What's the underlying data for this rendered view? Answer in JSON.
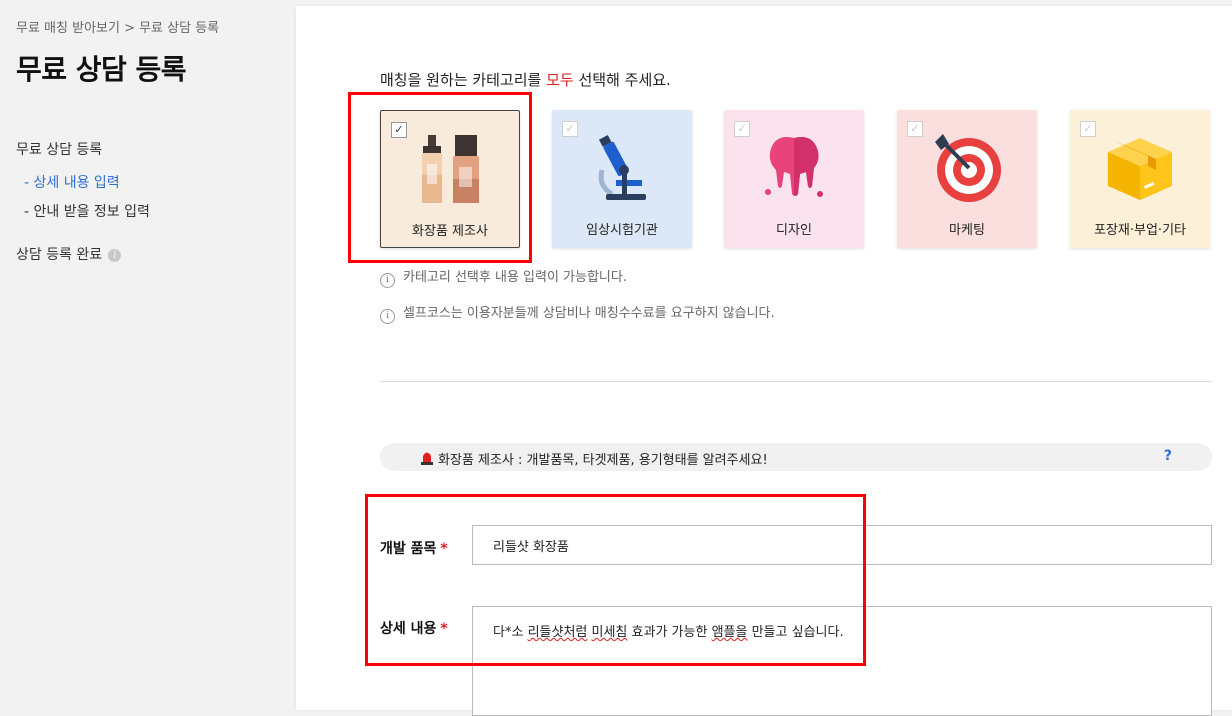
{
  "sidebar": {
    "breadcrumb": "무료 매칭 받아보기 > 무료 상담 등록",
    "title": "무료 상담 등록",
    "nav": {
      "section1": "무료 상담 등록",
      "sub1": "- 상세 내용 입력",
      "sub2": "- 안내 받을 정보 입력",
      "section2": "상담 등록 완료"
    }
  },
  "main": {
    "instruction_pre": "매칭을 원하는 카테고리를 ",
    "instruction_hl": "모두",
    "instruction_post": " 선택해 주세요.",
    "categories": [
      {
        "label": "화장품 제조사",
        "selected": true,
        "bg": "#f8ebdb",
        "icon": "cosmetics-bottles-icon"
      },
      {
        "label": "임상시험기관",
        "selected": false,
        "bg": "#dce7f7",
        "icon": "microscope-icon"
      },
      {
        "label": "디자인",
        "selected": false,
        "bg": "#fbe3ee",
        "icon": "paint-drip-icon"
      },
      {
        "label": "마케팅",
        "selected": false,
        "bg": "#fbdede",
        "icon": "target-dart-icon"
      },
      {
        "label": "포장재·부업·기타",
        "selected": false,
        "bg": "#fdf0d8",
        "icon": "box-icon"
      }
    ],
    "check_glyph": "✓",
    "info_glyph": "i",
    "notes": [
      "카테고리 선택후 내용 입력이 가능합니다.",
      "셀프코스는 이용자분들께 상담비나 매칭수수료를 요구하지 않습니다."
    ],
    "banner": {
      "text": "화장품 제조사  :   개발품목, 타겟제품, 용기형태를 알려주세요!",
      "help": "?"
    },
    "form": {
      "product_label": "개발 품목",
      "product_value": "리들샷 화장품",
      "detail_label": "상세 내용",
      "detail_parts": [
        "다*소 ",
        "리들샷처럼",
        " ",
        "미세침",
        " 효과가 가능한 ",
        "앰플을",
        " 만들고 싶습니다."
      ],
      "required_mark": "*"
    }
  }
}
